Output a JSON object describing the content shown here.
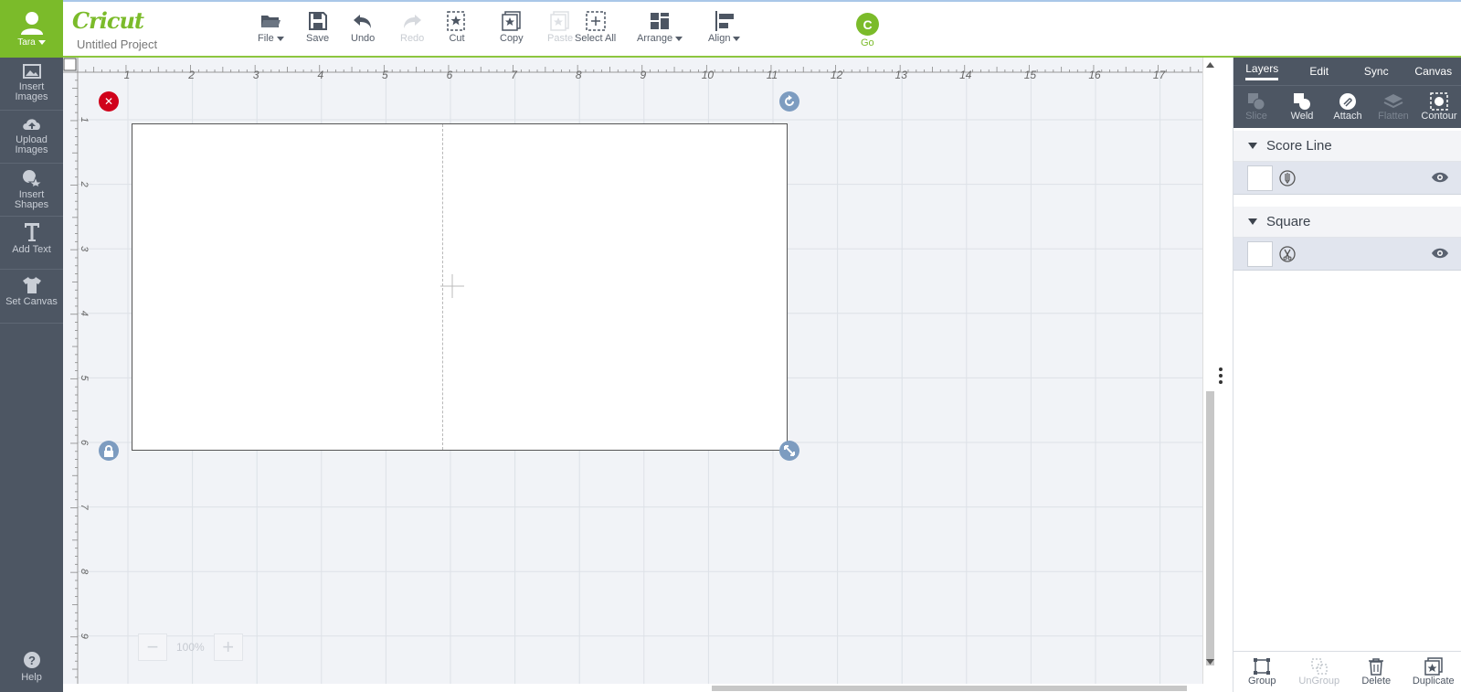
{
  "user": {
    "name": "Tara"
  },
  "sidebar": {
    "items": [
      {
        "label_line1": "Insert",
        "label_line2": "Images",
        "icon": "image-icon"
      },
      {
        "label_line1": "Upload",
        "label_line2": "Images",
        "icon": "cloud-upload-icon"
      },
      {
        "label_line1": "Insert",
        "label_line2": "Shapes",
        "icon": "shapes-icon"
      },
      {
        "label_line1": "Add Text",
        "label_line2": "",
        "icon": "text-icon"
      },
      {
        "label_line1": "Set Canvas",
        "label_line2": "",
        "icon": "tshirt-icon"
      }
    ],
    "help_label": "Help"
  },
  "header": {
    "logo": "Cricut",
    "project_title": "Untitled Project",
    "tools": {
      "file": "File",
      "save": "Save",
      "undo": "Undo",
      "redo": "Redo",
      "cut": "Cut",
      "copy": "Copy",
      "paste": "Paste",
      "select_all": "Select All",
      "arrange": "Arrange",
      "align": "Align",
      "go": "Go"
    }
  },
  "canvas": {
    "ruler_top": [
      "1",
      "2",
      "3",
      "4",
      "5",
      "6",
      "7",
      "8",
      "9",
      "10",
      "11",
      "12",
      "13",
      "14",
      "15",
      "16",
      "17"
    ],
    "ruler_left": [
      "1",
      "2",
      "3",
      "4",
      "5",
      "6",
      "7",
      "8",
      "9"
    ],
    "zoom_level": "100%"
  },
  "panel": {
    "tabs": [
      "Layers",
      "Edit",
      "Sync",
      "Canvas"
    ],
    "layer_tools": {
      "slice": "Slice",
      "weld": "Weld",
      "attach": "Attach",
      "flatten": "Flatten",
      "contour": "Contour"
    },
    "groups": [
      {
        "name": "Score Line",
        "operation_icon": "score-pen-icon"
      },
      {
        "name": "Square",
        "operation_icon": "scissors-icon"
      }
    ],
    "bottom_tools": {
      "group": "Group",
      "ungroup": "UnGroup",
      "delete": "Delete",
      "duplicate": "Duplicate"
    }
  },
  "colors": {
    "brand_green": "#7bbb2a",
    "sidebar": "#4d5663",
    "delete_red": "#d0021b",
    "handle_blue": "#7d9cc0"
  }
}
